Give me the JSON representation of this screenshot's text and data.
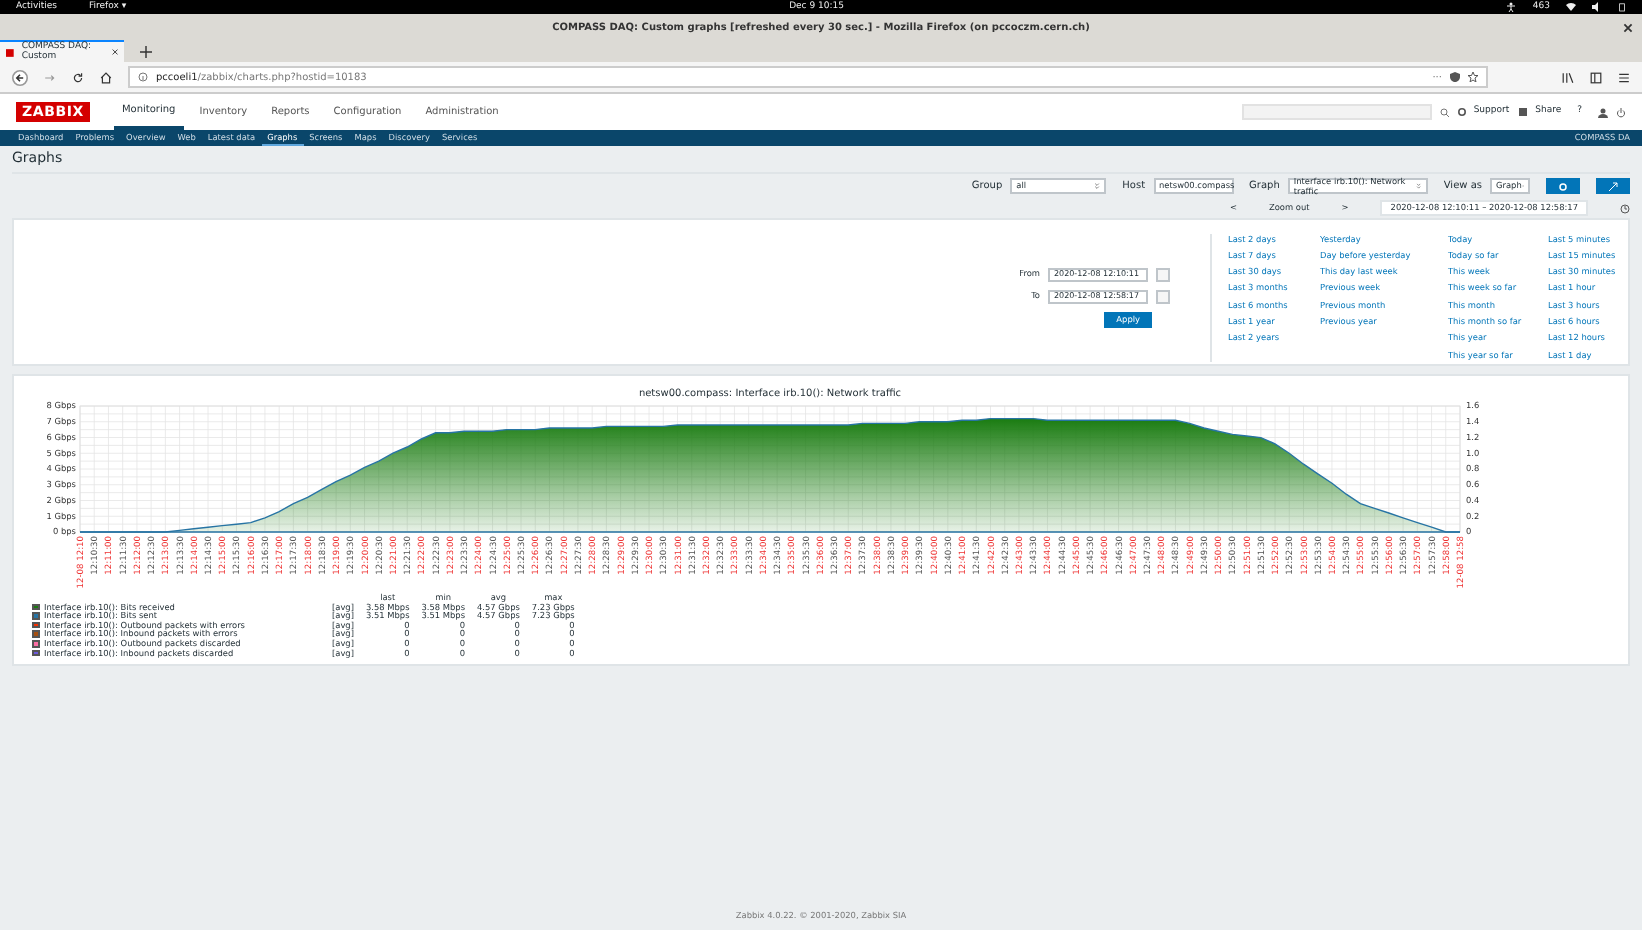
{
  "system_bar": {
    "activities": "Activities",
    "app": "Firefox ▾",
    "clock": "Dec 9  10:15",
    "counter": "463"
  },
  "window": {
    "title": "COMPASS DAQ: Custom graphs [refreshed every 30 sec.] - Mozilla Firefox (on pccoczm.cern.ch)"
  },
  "browser": {
    "tab": "COMPASS DAQ: Custom",
    "url_host": "pccoeli1",
    "url_path": "/zabbix/charts.php?hostid=10183",
    "page_actions": "···"
  },
  "header": {
    "logo": "ZABBIX",
    "menu": [
      {
        "label": "Monitoring",
        "selected": true
      },
      {
        "label": "Inventory",
        "selected": false
      },
      {
        "label": "Reports",
        "selected": false
      },
      {
        "label": "Configuration",
        "selected": false
      },
      {
        "label": "Administration",
        "selected": false
      }
    ],
    "support": "Support",
    "share": "Share",
    "help": "?"
  },
  "subnav": {
    "items": [
      {
        "label": "Dashboard",
        "selected": false
      },
      {
        "label": "Problems",
        "selected": false
      },
      {
        "label": "Overview",
        "selected": false
      },
      {
        "label": "Web",
        "selected": false
      },
      {
        "label": "Latest data",
        "selected": false
      },
      {
        "label": "Graphs",
        "selected": true
      },
      {
        "label": "Screens",
        "selected": false
      },
      {
        "label": "Maps",
        "selected": false
      },
      {
        "label": "Discovery",
        "selected": false
      },
      {
        "label": "Services",
        "selected": false
      }
    ],
    "server": "COMPASS DA"
  },
  "page": {
    "title": "Graphs"
  },
  "filters": [
    {
      "label": "Group",
      "value": "all"
    },
    {
      "label": "Host",
      "value": "netsw00.compass"
    },
    {
      "label": "Graph",
      "value": "Interface irb.10(): Network traffic"
    },
    {
      "label": "View as",
      "value": "Graph"
    }
  ],
  "time_bar": {
    "prev": "<",
    "zoom_out": "Zoom out",
    "next": ">",
    "range": "2020-12-08 12:10:11 – 2020-12-08 12:58:17"
  },
  "time_filter": {
    "from_label": "From",
    "from": "2020-12-08 12:10:11",
    "to_label": "To",
    "to": "2020-12-08 12:58:17",
    "apply": "Apply",
    "quick_ranges": [
      [
        "Last 2 days",
        "Last 7 days",
        "Last 30 days",
        "Last 3 months",
        "Last 6 months",
        "Last 1 year",
        "Last 2 years"
      ],
      [
        "Yesterday",
        "Day before yesterday",
        "This day last week",
        "Previous week",
        "Previous month",
        "Previous year"
      ],
      [
        "Today",
        "Today so far",
        "This week",
        "This week so far",
        "This month",
        "This month so far",
        "This year",
        "This year so far"
      ],
      [
        "Last 5 minutes",
        "Last 15 minutes",
        "Last 30 minutes",
        "Last 1 hour",
        "Last 3 hours",
        "Last 6 hours",
        "Last 12 hours",
        "Last 1 day"
      ]
    ]
  },
  "graph": {
    "chart_data": {
      "type": "area",
      "title": "netsw00.compass: Interface irb.10(): Network traffic",
      "ylim": [
        0,
        8
      ],
      "yticks": [
        {
          "value": 0,
          "label": "0 bps"
        },
        {
          "value": 1,
          "label": "1 Gbps"
        },
        {
          "value": 2,
          "label": "2 Gbps"
        },
        {
          "value": 3,
          "label": "3 Gbps"
        },
        {
          "value": 4,
          "label": "4 Gbps"
        },
        {
          "value": 5,
          "label": "5 Gbps"
        },
        {
          "value": 6,
          "label": "6 Gbps"
        },
        {
          "value": 7,
          "label": "7 Gbps"
        },
        {
          "value": 8,
          "label": "8 Gbps"
        }
      ],
      "y2ticks": [
        "0",
        "0.2",
        "0.4",
        "0.6",
        "0.8",
        "1.0",
        "1.2",
        "1.4",
        "1.6"
      ],
      "categories": [
        "12-08 12:10",
        "12:10:30",
        "12:11:00",
        "12:11:30",
        "12:12:00",
        "12:12:30",
        "12:13:00",
        "12:13:30",
        "12:14:00",
        "12:14:30",
        "12:15:00",
        "12:15:30",
        "12:16:00",
        "12:16:30",
        "12:17:00",
        "12:17:30",
        "12:18:00",
        "12:18:30",
        "12:19:00",
        "12:19:30",
        "12:20:00",
        "12:20:30",
        "12:21:00",
        "12:21:30",
        "12:22:00",
        "12:22:30",
        "12:23:00",
        "12:23:30",
        "12:24:00",
        "12:24:30",
        "12:25:00",
        "12:25:30",
        "12:26:00",
        "12:26:30",
        "12:27:00",
        "12:27:30",
        "12:28:00",
        "12:28:30",
        "12:29:00",
        "12:29:30",
        "12:30:00",
        "12:30:30",
        "12:31:00",
        "12:31:30",
        "12:32:00",
        "12:32:30",
        "12:33:00",
        "12:33:30",
        "12:34:00",
        "12:34:30",
        "12:35:00",
        "12:35:30",
        "12:36:00",
        "12:36:30",
        "12:37:00",
        "12:37:30",
        "12:38:00",
        "12:38:30",
        "12:39:00",
        "12:39:30",
        "12:40:00",
        "12:40:30",
        "12:41:00",
        "12:41:30",
        "12:42:00",
        "12:42:30",
        "12:43:00",
        "12:43:30",
        "12:44:00",
        "12:44:30",
        "12:45:00",
        "12:45:30",
        "12:46:00",
        "12:46:30",
        "12:47:00",
        "12:47:30",
        "12:48:00",
        "12:48:30",
        "12:49:00",
        "12:49:30",
        "12:50:00",
        "12:50:30",
        "12:51:00",
        "12:51:30",
        "12:52:00",
        "12:52:30",
        "12:53:00",
        "12:53:30",
        "12:54:00",
        "12:54:30",
        "12:55:00",
        "12:55:30",
        "12:56:00",
        "12:56:30",
        "12:57:00",
        "12:57:30",
        "12:58:00",
        "12-08 12:58"
      ],
      "grid": true,
      "series": [
        {
          "color": "#1a7c11",
          "values": [
            0,
            0,
            0,
            0,
            0,
            0,
            0,
            0.1,
            0.2,
            0.3,
            0.4,
            0.5,
            0.6,
            0.9,
            1.3,
            1.8,
            2.2,
            2.7,
            3.2,
            3.6,
            4.1,
            4.5,
            5.0,
            5.4,
            5.9,
            6.3,
            6.3,
            6.4,
            6.4,
            6.4,
            6.5,
            6.5,
            6.5,
            6.6,
            6.6,
            6.6,
            6.6,
            6.7,
            6.7,
            6.7,
            6.7,
            6.7,
            6.8,
            6.8,
            6.8,
            6.8,
            6.8,
            6.8,
            6.8,
            6.8,
            6.8,
            6.8,
            6.8,
            6.8,
            6.8,
            6.9,
            6.9,
            6.9,
            6.9,
            7.0,
            7.0,
            7.0,
            7.1,
            7.1,
            7.2,
            7.2,
            7.2,
            7.2,
            7.1,
            7.1,
            7.1,
            7.1,
            7.1,
            7.1,
            7.1,
            7.1,
            7.1,
            7.1,
            6.9,
            6.6,
            6.4,
            6.2,
            6.1,
            6.0,
            5.6,
            5.0,
            4.3,
            3.7,
            3.1,
            2.4,
            1.8,
            1.5,
            1.2,
            0.9,
            0.6,
            0.3,
            0,
            0
          ]
        }
      ]
    },
    "legend_headers": [
      "last",
      "min",
      "avg",
      "max"
    ],
    "legend": [
      {
        "name": "Interface irb.10(): Bits received",
        "color": "#1a7c11",
        "func": "[avg]",
        "last": "3.58 Mbps",
        "min": "3.58 Mbps",
        "avg": "4.57 Gbps",
        "max": "7.23 Gbps"
      },
      {
        "name": "Interface irb.10(): Bits sent",
        "color": "#2774a4",
        "func": "[avg]",
        "last": "3.51 Mbps",
        "min": "3.51 Mbps",
        "avg": "4.57 Gbps",
        "max": "7.23 Gbps"
      },
      {
        "name": "Interface irb.10(): Outbound packets with errors",
        "color": "#f63100",
        "func": "[avg]",
        "last": "0",
        "min": "0",
        "avg": "0",
        "max": "0"
      },
      {
        "name": "Interface irb.10(): Inbound packets with errors",
        "color": "#a54f10",
        "func": "[avg]",
        "last": "0",
        "min": "0",
        "avg": "0",
        "max": "0"
      },
      {
        "name": "Interface irb.10(): Outbound packets discarded",
        "color": "#fc6ea3",
        "func": "[avg]",
        "last": "0",
        "min": "0",
        "avg": "0",
        "max": "0"
      },
      {
        "name": "Interface irb.10(): Inbound packets discarded",
        "color": "#6c59dc",
        "func": "[avg]",
        "last": "0",
        "min": "0",
        "avg": "0",
        "max": "0"
      }
    ]
  },
  "footer": "Zabbix 4.0.22. © 2001-2020, Zabbix SIA"
}
